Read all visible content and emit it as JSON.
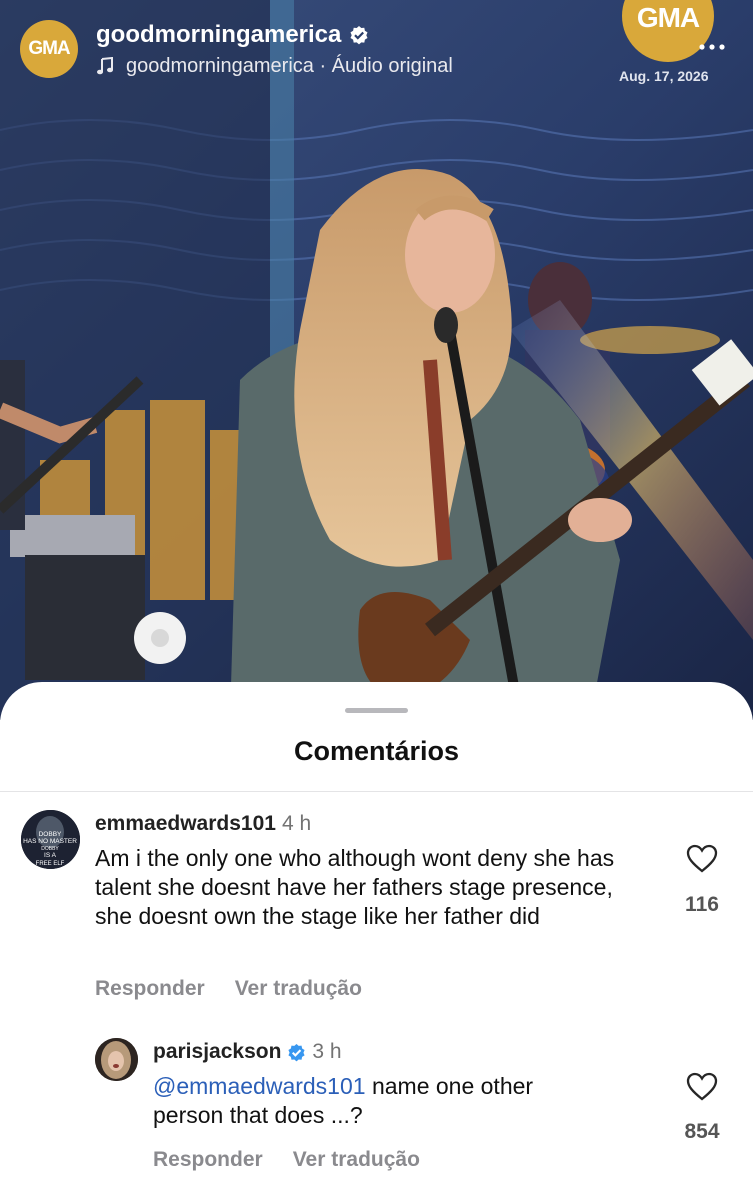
{
  "reel": {
    "account_name": "goodmorningamerica",
    "account_avatar_text": "GMA",
    "audio_label": "goodmorningamerica · Áudio original",
    "corner_logo_text": "GMA",
    "date": "Aug. 17, 2026",
    "icons": [
      "verified-badge-icon",
      "music-note-icon",
      "more-options-icon"
    ]
  },
  "comments_panel": {
    "title": "Comentários",
    "comments": [
      {
        "username": "emmaedwards101",
        "time": "4 h",
        "text": "Am i the only one who although wont deny she has talent she doesnt have her fathers stage presence, she doesnt own the stage like her father did",
        "likes": "116",
        "reply_label": "Responder",
        "translate_label": "Ver tradução",
        "avatar_caption": [
          "DOBBY",
          "HAS NO MASTER",
          "DOBBY",
          "IS A",
          "FREE ELF"
        ]
      },
      {
        "username": "parisjackson",
        "verified": true,
        "time": "3 h",
        "mention": "@emmaedwards101",
        "text": "name one other person that does ...?",
        "likes": "854",
        "reply_label": "Responder",
        "translate_label": "Ver tradução"
      }
    ]
  },
  "colors": {
    "gma_gold": "#d9a83a",
    "verified_blue": "#3897f0",
    "mention_blue": "#2b5fb8"
  }
}
